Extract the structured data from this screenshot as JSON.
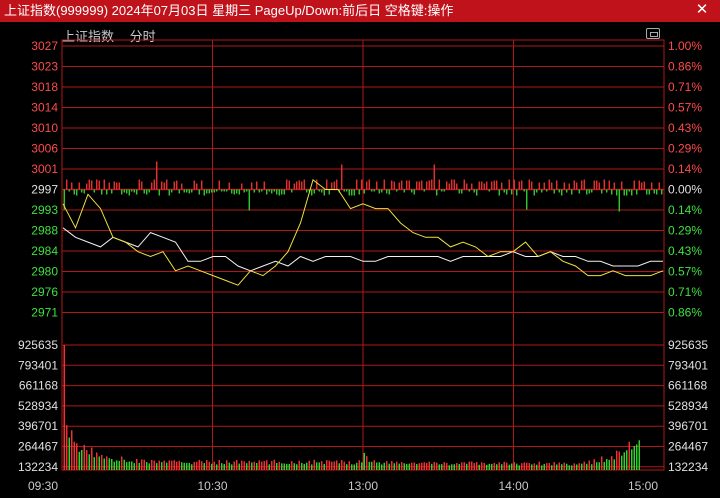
{
  "window": {
    "title": "上证指数(999999) 2024年07月03日 星期三 PageUp/Down:前后日 空格键:操作",
    "close_glyph": "✕"
  },
  "chart_header": {
    "name": "上证指数",
    "mode": "分时"
  },
  "colors": {
    "grid": "#b01818",
    "up_label": "#ff4a4a",
    "down_label": "#3fe03f",
    "neutral_label": "#e0e0e0",
    "volume_label": "#e0e0e0",
    "price_line": "#f2f2f2",
    "avg_line": "#f0e040",
    "up_bar": "#ff3333",
    "down_bar": "#33dd33",
    "time_label": "#c8c8c8"
  },
  "chart_data": {
    "type": "line",
    "prev_close": 2997,
    "price_axis": {
      "left_ticks": [
        "3027",
        "3023",
        "3018",
        "3014",
        "3010",
        "3006",
        "3001",
        "2997",
        "2993",
        "2988",
        "2984",
        "2980",
        "2976",
        "2971"
      ],
      "right_ticks": [
        "1.00%",
        "0.86%",
        "0.71%",
        "0.57%",
        "0.43%",
        "0.29%",
        "0.14%",
        "0.00%",
        "0.14%",
        "0.29%",
        "0.43%",
        "0.57%",
        "0.71%",
        "0.86%"
      ],
      "ylim": [
        2967,
        3027
      ]
    },
    "volume_axis": {
      "ticks": [
        "925635",
        "793401",
        "661168",
        "528934",
        "396701",
        "264467",
        "132234"
      ]
    },
    "x_ticks": [
      "09:30",
      "10:30",
      "13:00",
      "14:00",
      "15:00"
    ],
    "price_series": {
      "name": "",
      "x": [
        0,
        5,
        10,
        15,
        20,
        25,
        30,
        35,
        40,
        45,
        50,
        55,
        60,
        65,
        70,
        75,
        80,
        85,
        90,
        95,
        100,
        105,
        110,
        115,
        120,
        125,
        130,
        135,
        140,
        145,
        150,
        155,
        160,
        165,
        170,
        175,
        180,
        185,
        190,
        195,
        200,
        205,
        210,
        215,
        220,
        225,
        230,
        235,
        240
      ],
      "values": [
        2989,
        2987,
        2986,
        2985,
        2987,
        2986,
        2985,
        2988,
        2987,
        2986,
        2982,
        2982,
        2983,
        2983,
        2981,
        2980,
        2981,
        2982,
        2981,
        2983,
        2982,
        2983,
        2983,
        2983,
        2982,
        2982,
        2983,
        2983,
        2983,
        2983,
        2983,
        2982,
        2983,
        2983,
        2983,
        2983,
        2984,
        2983,
        2983,
        2984,
        2983,
        2983,
        2982,
        2982,
        2981,
        2981,
        2981,
        2982,
        2982
      ]
    },
    "avg_series": {
      "name": "",
      "x": [
        0,
        5,
        10,
        15,
        20,
        25,
        30,
        35,
        40,
        45,
        50,
        55,
        60,
        65,
        70,
        75,
        80,
        85,
        90,
        95,
        100,
        105,
        110,
        115,
        120,
        125,
        130,
        135,
        140,
        145,
        150,
        155,
        160,
        165,
        170,
        175,
        180,
        185,
        190,
        195,
        200,
        205,
        210,
        215,
        220,
        225,
        230,
        235,
        240
      ],
      "values": [
        2994,
        2989,
        2996,
        2993,
        2987,
        2986,
        2984,
        2983,
        2984,
        2980,
        2981,
        2980,
        2979,
        2978,
        2977,
        2980,
        2979,
        2981,
        2984,
        2990,
        2999,
        2997,
        2997,
        2993,
        2994,
        2993,
        2993,
        2990,
        2988,
        2987,
        2987,
        2985,
        2986,
        2985,
        2983,
        2984,
        2984,
        2986,
        2983,
        2984,
        2982,
        2981,
        2979,
        2979,
        2980,
        2979,
        2979,
        2979,
        2980
      ]
    },
    "volume": {
      "values": [
        930000,
        310000,
        270000,
        240000,
        215000,
        200000,
        185000,
        175000,
        165000,
        150000,
        140000,
        135000,
        125000,
        120000,
        112000,
        108000,
        104000,
        100000,
        96000,
        92000,
        88000,
        85000,
        82000,
        80000,
        78000,
        76000,
        74000,
        72000,
        70000,
        69000,
        68000,
        67000,
        66000,
        66000,
        65000,
        64000,
        64000,
        63000,
        63000,
        62000,
        62000,
        62000,
        61000,
        61000,
        60000,
        60000,
        60000,
        60000,
        60000,
        60000,
        60000,
        60000,
        60000,
        60000,
        60000,
        60000,
        60000,
        60000,
        60000,
        60000,
        60000,
        60000,
        60000,
        60000,
        60000,
        60000,
        60000,
        60000,
        60000,
        60000,
        60000,
        60000,
        60000,
        60000,
        60000,
        60000,
        60000,
        60000,
        60000,
        60000,
        60000,
        60000,
        60000,
        60000,
        60000,
        60000,
        60000,
        60000,
        60000,
        60000,
        60000,
        60000,
        60000,
        60000,
        60000,
        60000,
        60000,
        60000,
        60000,
        60000,
        60000,
        60000,
        60000,
        60000,
        60000,
        60000,
        60000,
        60000,
        60000,
        60000,
        60000,
        60000,
        60000,
        60000,
        60000,
        60000,
        60000,
        60000,
        60000,
        60000,
        180000,
        90000,
        75000,
        70000,
        65000,
        62000,
        60000,
        58000,
        57000,
        56000,
        55000,
        55000,
        54000,
        54000,
        54000,
        53000,
        53000,
        53000,
        52000,
        52000,
        52000,
        52000,
        51000,
        51000,
        51000,
        51000,
        50000,
        50000,
        50000,
        50000,
        50000,
        50000,
        50000,
        50000,
        50000,
        50000,
        50000,
        50000,
        50000,
        50000,
        50000,
        50000,
        50000,
        50000,
        50000,
        50000,
        50000,
        50000,
        50000,
        50000,
        50000,
        50000,
        50000,
        50000,
        50000,
        50000,
        50000,
        50000,
        50000,
        50000,
        50000,
        50000,
        50000,
        50000,
        50000,
        50000,
        50000,
        50000,
        50000,
        50000,
        50000,
        50000,
        50000,
        50000,
        50000,
        50000,
        50000,
        50000,
        50000,
        50000,
        50000,
        50000,
        50000,
        50000,
        50000,
        50000,
        50000,
        50000,
        50000,
        50000,
        55000,
        60000,
        65000,
        70000,
        75000,
        80000,
        85000,
        90000,
        95000,
        100000,
        110000,
        120000,
        130000,
        140000,
        150000,
        160000,
        170000,
        180000,
        190000,
        200000,
        260000
      ],
      "ylim": [
        0,
        1000000
      ]
    }
  }
}
